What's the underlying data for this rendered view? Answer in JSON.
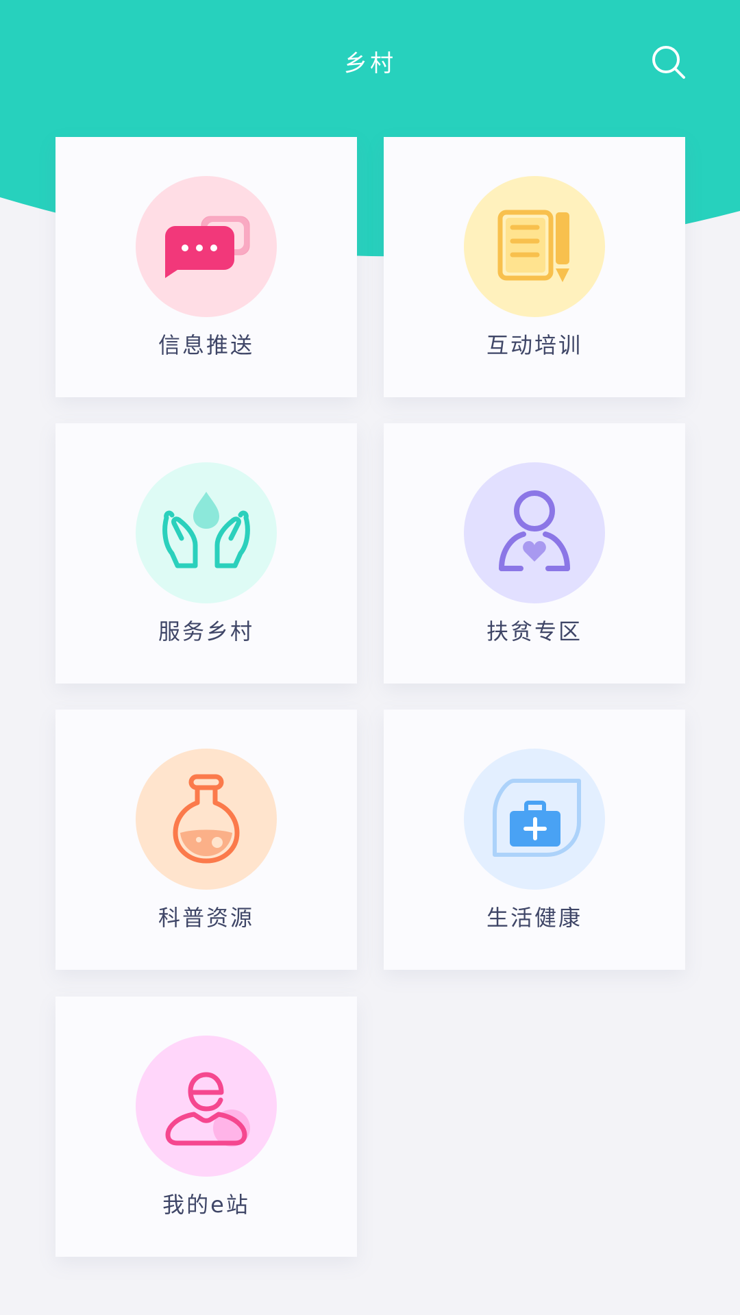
{
  "header": {
    "title": "乡村",
    "search_icon": "search-icon",
    "color": "#27d1bd"
  },
  "tiles": [
    {
      "label": "信息推送",
      "icon": "chat-bubbles-icon",
      "circle_color": "#ffdde5",
      "icon_color": "#f2387a"
    },
    {
      "label": "互动培训",
      "icon": "notepad-pencil-icon",
      "circle_color": "#fff1bd",
      "icon_color": "#f8c04d"
    },
    {
      "label": "服务乡村",
      "icon": "hands-water-drop-icon",
      "circle_color": "#defbf5",
      "icon_color": "#2bd0bc"
    },
    {
      "label": "扶贫专区",
      "icon": "person-heart-icon",
      "circle_color": "#e2e0ff",
      "icon_color": "#8b76e6"
    },
    {
      "label": "科普资源",
      "icon": "flask-icon",
      "circle_color": "#ffe4cd",
      "icon_color": "#fb7a4b"
    },
    {
      "label": "生活健康",
      "icon": "medical-kit-icon",
      "circle_color": "#e3efff",
      "icon_color": "#49a2f4"
    },
    {
      "label": "我的e站",
      "icon": "e-user-icon",
      "circle_color": "#ffd6fa",
      "icon_color": "#f5478f"
    }
  ]
}
